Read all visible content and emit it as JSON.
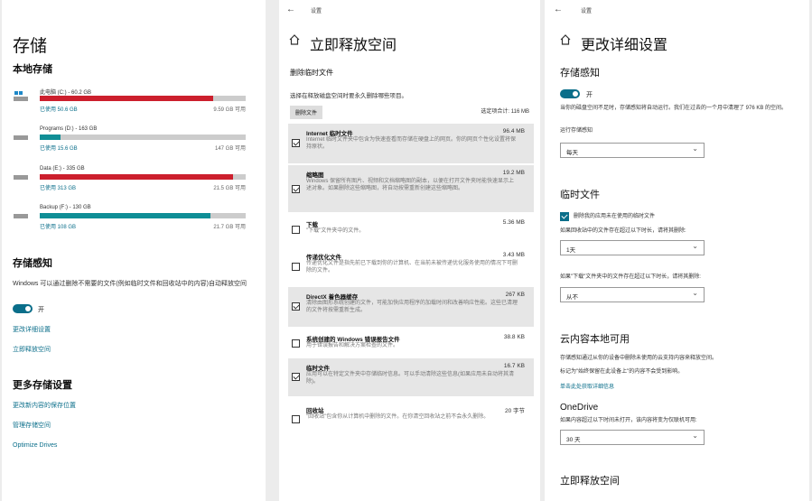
{
  "storage": {
    "title": "存储",
    "local_heading": "本地存储",
    "drives": [
      {
        "name": "此电脑 (C:) - 60.2 GB",
        "used": "已使用 50.6 GB",
        "free": "9.59 GB 可用",
        "fraction": 0.84,
        "color": "#cc1f2d"
      },
      {
        "name": "Programs (D:) - 163 GB",
        "used": "已使用 15.6 GB",
        "free": "147 GB 可用",
        "fraction": 0.1,
        "color": "#0f8e96"
      },
      {
        "name": "Data (E:) - 335 GB",
        "used": "已使用 313 GB",
        "free": "21.5 GB 可用",
        "fraction": 0.94,
        "color": "#cc1f2d"
      },
      {
        "name": "Backup (F:) - 130 GB",
        "used": "已使用 108 GB",
        "free": "21.7 GB 可用",
        "fraction": 0.83,
        "color": "#0f8e96"
      }
    ],
    "sense_heading": "存储感知",
    "sense_desc": "Windows 可以通过删除不需要的文件(例如临时文件和回收站中的内容)自动释放空间",
    "sense_toggle_label": "开",
    "sense_links": [
      "更改详细设置",
      "立即释放空间"
    ],
    "more_heading": "更多存储设置",
    "more_links": [
      "更改新内容的保存位置",
      "管理存储空间",
      "Optimize Drives"
    ]
  },
  "free_up": {
    "titlebar": "设置",
    "heading": "立即释放空间",
    "section": "删除临时文件",
    "desc": "选择在释放磁盘空间时要永久删除哪些项目。",
    "remove_button": "删除文件",
    "total": "选定项合计: 116 MB",
    "items": [
      {
        "name": "Internet 临时文件",
        "size": "96.4 MB",
        "checked": true,
        "desc": "Internet 临时文件夹中包含为快速查看而存储在硬盘上的网页。你的网页个性化设置将保持原状。"
      },
      {
        "name": "缩略图",
        "size": "19.2 MB",
        "checked": true,
        "desc": "Windows 保留所有图片、视频和文档缩略图的副本，以便在打开文件夹时能快速显示上述对象。如果删除这些缩略图，将自动按需重新创建这些缩略图。"
      },
      {
        "name": "下载",
        "size": "5.36 MB",
        "checked": false,
        "desc": "\"下载\"文件夹中的文件。"
      },
      {
        "name": "传递优化文件",
        "size": "3.43 MB",
        "checked": false,
        "desc": "传递优化文件是指先前已下载到你的计算机、在当前未被传递优化服务使用的情况下可删除的文件。"
      },
      {
        "name": "DirectX 着色器缓存",
        "size": "267 KB",
        "checked": true,
        "desc": "清除由图形系统创建的文件，可能加快应用程序的加载时间和改善响应性能。这些已清理的文件将按需重新生成。"
      },
      {
        "name": "系统创建的 Windows 错误报告文件",
        "size": "38.8 KB",
        "checked": false,
        "desc": "用于错误报告和解决方案检查的文件。"
      },
      {
        "name": "临时文件",
        "size": "16.7 KB",
        "checked": true,
        "desc": "应用可以在特定文件夹中存储临时信息。可以手动清除这些信息(如果应用未自动将其清除)。"
      },
      {
        "name": "回收站",
        "size": "20 字节",
        "checked": false,
        "desc": "\"回收站\"包含你从计算机中删除的文件。在你清空回收站之前不会永久删除。"
      }
    ]
  },
  "details": {
    "titlebar": "设置",
    "heading": "更改详细设置",
    "sense_title": "存储感知",
    "toggle_label": "开",
    "sense_desc": "当你的磁盘空间不足时，存储感知将自动运行。我们在过去的一个月中清理了 976 KB 的空间。",
    "run_label": "运行存储感知",
    "run_value": "每天",
    "temp_title": "临时文件",
    "temp_checkbox": "删除我的应用未在使用的临时文件",
    "recycle_label": "如果回收站中的文件存在超过以下时长，请将其删除:",
    "recycle_value": "1天",
    "download_label": "如果\"下载\"文件夹中的文件存在超过以下时长，请将其删除:",
    "download_value": "从不",
    "cloud_title": "云内容本地可用",
    "cloud_desc": "存储感知通过从你的设备中删除未使用的云支持内容来释放空间。",
    "cloud_desc2": "标记为\"始终保留在此设备上\"的内容不会受到影响。",
    "cloud_link": "单击此处获取详细信息",
    "onedrive_title": "OneDrive",
    "onedrive_desc": "如果内容超过以下时间未打开，该内容将变为仅联机可用:",
    "onedrive_value": "30 天",
    "free_title": "立即释放空间"
  }
}
